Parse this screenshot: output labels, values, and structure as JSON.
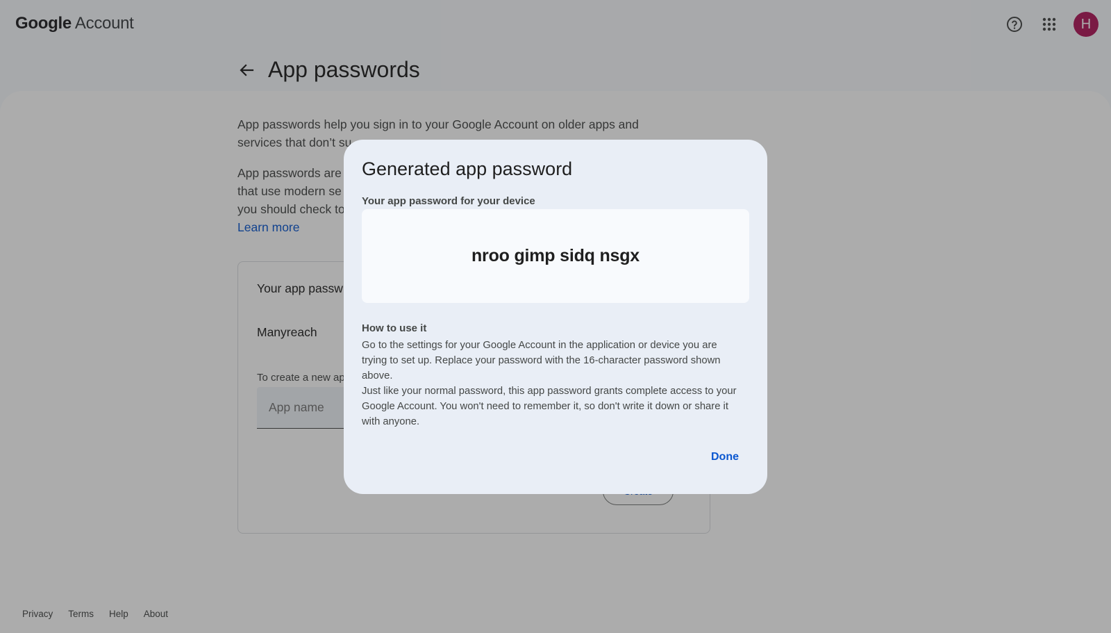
{
  "header": {
    "logo_google": "Google",
    "logo_account": "Account",
    "avatar_letter": "H"
  },
  "page": {
    "title": "App passwords"
  },
  "intro": {
    "paragraph1": "App passwords help you sign in to your Google Account on older apps and services that don’t su",
    "paragraph2_line1": "App passwords are",
    "paragraph2_line2": "that use modern se",
    "paragraph2_line3": "you should check to",
    "learn_more": "Learn more"
  },
  "card": {
    "title": "Your app passw",
    "item": "Manyreach",
    "hint": "To create a new ap",
    "input_placeholder": "App name",
    "create_label": "Create"
  },
  "footer": {
    "links": [
      "Privacy",
      "Terms",
      "Help",
      "About"
    ]
  },
  "dialog": {
    "title": "Generated app password",
    "subtitle": "Your app password for your device",
    "password": "nroo gimp sidq nsgx",
    "howto_heading": "How to use it",
    "howto_p1": "Go to the settings for your Google Account in the application or device you are trying to set up. Replace your password with the 16-character password shown above.",
    "howto_p2": "Just like your normal password, this app password grants complete access to your Google Account. You won't need to remember it, so don't write it down or share it with anyone.",
    "done_label": "Done"
  },
  "icons": {
    "help": "help-circle-icon",
    "apps": "apps-grid-icon",
    "back": "arrow-back-icon"
  },
  "colors": {
    "accent": "#0b57d0",
    "avatar": "#b0185b",
    "dialog_bg": "#e9eef6"
  }
}
